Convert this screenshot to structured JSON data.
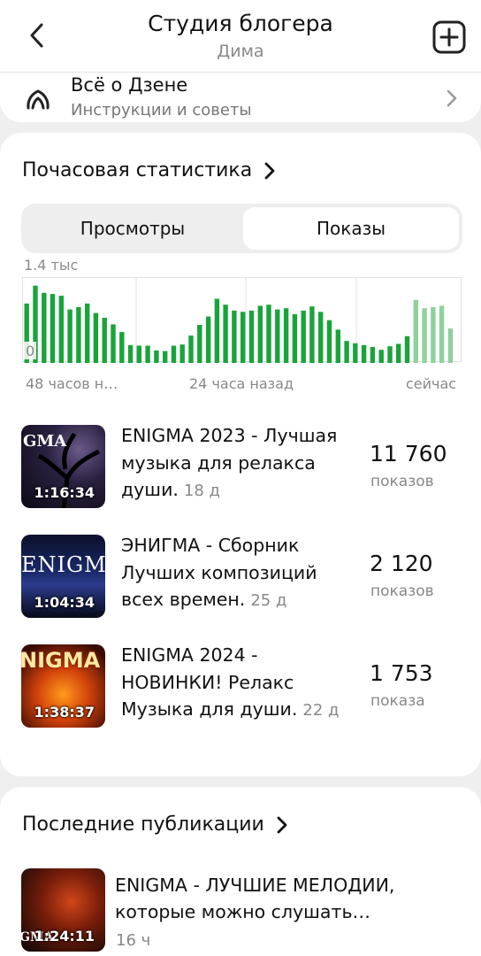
{
  "header": {
    "title": "Студия блогера",
    "subtitle": "Дима"
  },
  "tips": {
    "title_cut": "Всё о Дзене",
    "subtitle": "Инструкции и советы"
  },
  "stats": {
    "section_title": "Почасовая статистика",
    "tabs": [
      "Просмотры",
      "Показы"
    ],
    "selected_tab": "Показы",
    "y_max_label": "1.4 тыс",
    "y_min_label": "0",
    "x_labels": [
      "48 часов н…",
      "24 часа назад",
      "сейчас"
    ],
    "colors": {
      "bar": "#1aa33a",
      "bar_recent": "#8fd19d",
      "grid": "#e0e0e0"
    }
  },
  "chart_data": {
    "type": "bar",
    "ylim": [
      0,
      1400
    ],
    "values": [
      1000,
      1300,
      1180,
      1160,
      1130,
      900,
      940,
      1000,
      840,
      760,
      650,
      520,
      300,
      290,
      290,
      210,
      200,
      290,
      310,
      460,
      640,
      780,
      1080,
      980,
      880,
      860,
      880,
      960,
      980,
      900,
      920,
      820,
      880,
      950,
      860,
      720,
      560,
      370,
      330,
      300,
      270,
      220,
      280,
      320,
      450
    ],
    "values_recent": [
      1060,
      920,
      940,
      960,
      580
    ],
    "title": "",
    "xlabel": "",
    "ylabel": ""
  },
  "videos": [
    {
      "title": "ENIGMA 2023 - Лучшая музыка для релакса души.",
      "age": "18 д",
      "count": "11 760",
      "unit": "показов",
      "duration": "1:16:34",
      "thumb_text": "GMA"
    },
    {
      "title": "ЭНИГМА - Сборник Лучших композиций всех времен.",
      "age": "25 д",
      "count": "2 120",
      "unit": "показов",
      "duration": "1:04:34",
      "thumb_text": "ENIGM"
    },
    {
      "title": "ENIGMA 2024 - НОВИНКИ! Релакс Музыка для души.",
      "age": "22 д",
      "count": "1 753",
      "unit": "показа",
      "duration": "1:38:37",
      "thumb_text": "NIGMA"
    }
  ],
  "publications": {
    "section_title": "Последние публикации",
    "items": [
      {
        "title": "ENIGMA - ЛУЧШИЕ МЕЛОДИИ, которые можно слушать…",
        "age": "16 ч",
        "duration": "1:24:11",
        "thumb_text": "GMA"
      }
    ]
  }
}
